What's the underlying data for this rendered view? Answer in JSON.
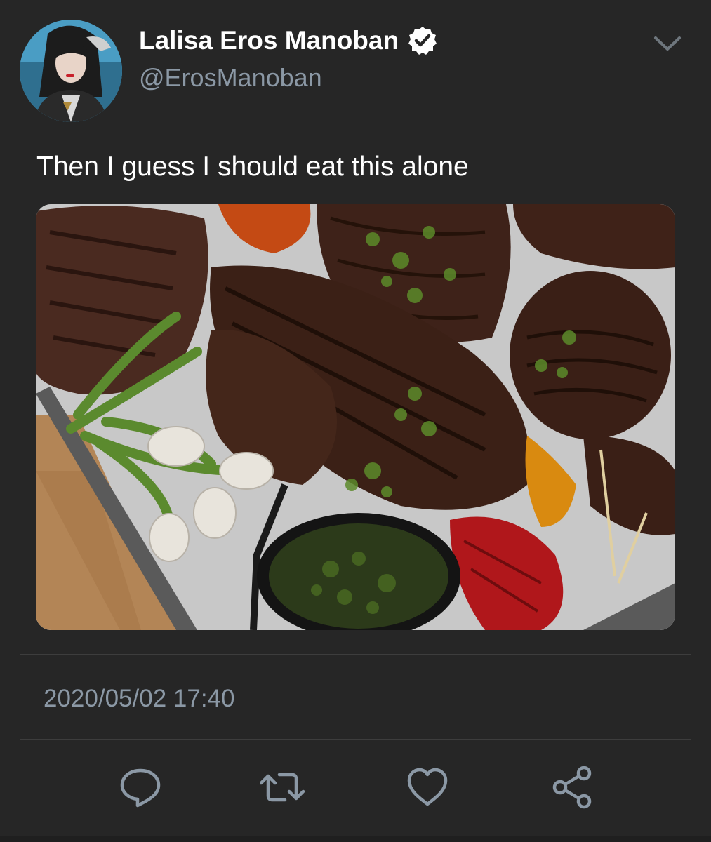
{
  "author": {
    "display_name": "Lalisa Eros Manoban",
    "handle": "@ErosManoban",
    "verified": true,
    "avatar_icon": "profile-photo"
  },
  "tweet": {
    "text": "Then I guess I should eat this alone",
    "media": {
      "type": "photo",
      "subject": "grilled steaks with vegetables and chimichurri"
    },
    "timestamp": "2020/05/02 17:40"
  },
  "actions": [
    {
      "name": "reply",
      "icon": "reply-bubble-icon"
    },
    {
      "name": "retweet",
      "icon": "retweet-arrows-icon"
    },
    {
      "name": "like",
      "icon": "heart-icon"
    },
    {
      "name": "share",
      "icon": "share-nodes-icon"
    }
  ],
  "colors": {
    "background": "#262626",
    "text_primary": "#ffffff",
    "text_secondary": "#8b98a5",
    "divider": "#3d3d3d"
  }
}
